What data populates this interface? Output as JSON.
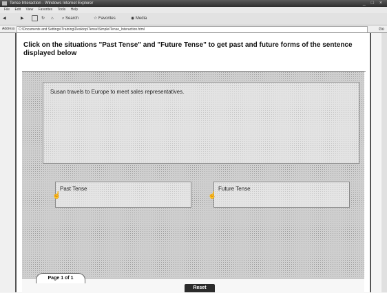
{
  "window": {
    "title": "Tense Interaction - Windows Internet Explorer",
    "controls": "_ □ ×"
  },
  "menu": {
    "items": [
      "File",
      "Edit",
      "View",
      "Favorites",
      "Tools",
      "Help"
    ]
  },
  "toolbar": {
    "search_label": "Search",
    "favorites_label": "Favorites",
    "media_label": "Media"
  },
  "address": {
    "label": "Address",
    "url": "C:\\Documents and Settings\\Training\\Desktop\\Tense\\Simple\\Tense_Interaction.html",
    "go_label": "Go"
  },
  "instruction": "Click on the situations \"Past Tense\" and \"Future Tense\" to get past and future forms of the sentence displayed below",
  "sentence": "Susan travels to Europe to meet sales representatives.",
  "options": {
    "past_label": "Past Tense",
    "future_label": "Future Tense"
  },
  "footer": {
    "page_indicator": "Page 1 of 1",
    "reset_label": "Reset"
  }
}
